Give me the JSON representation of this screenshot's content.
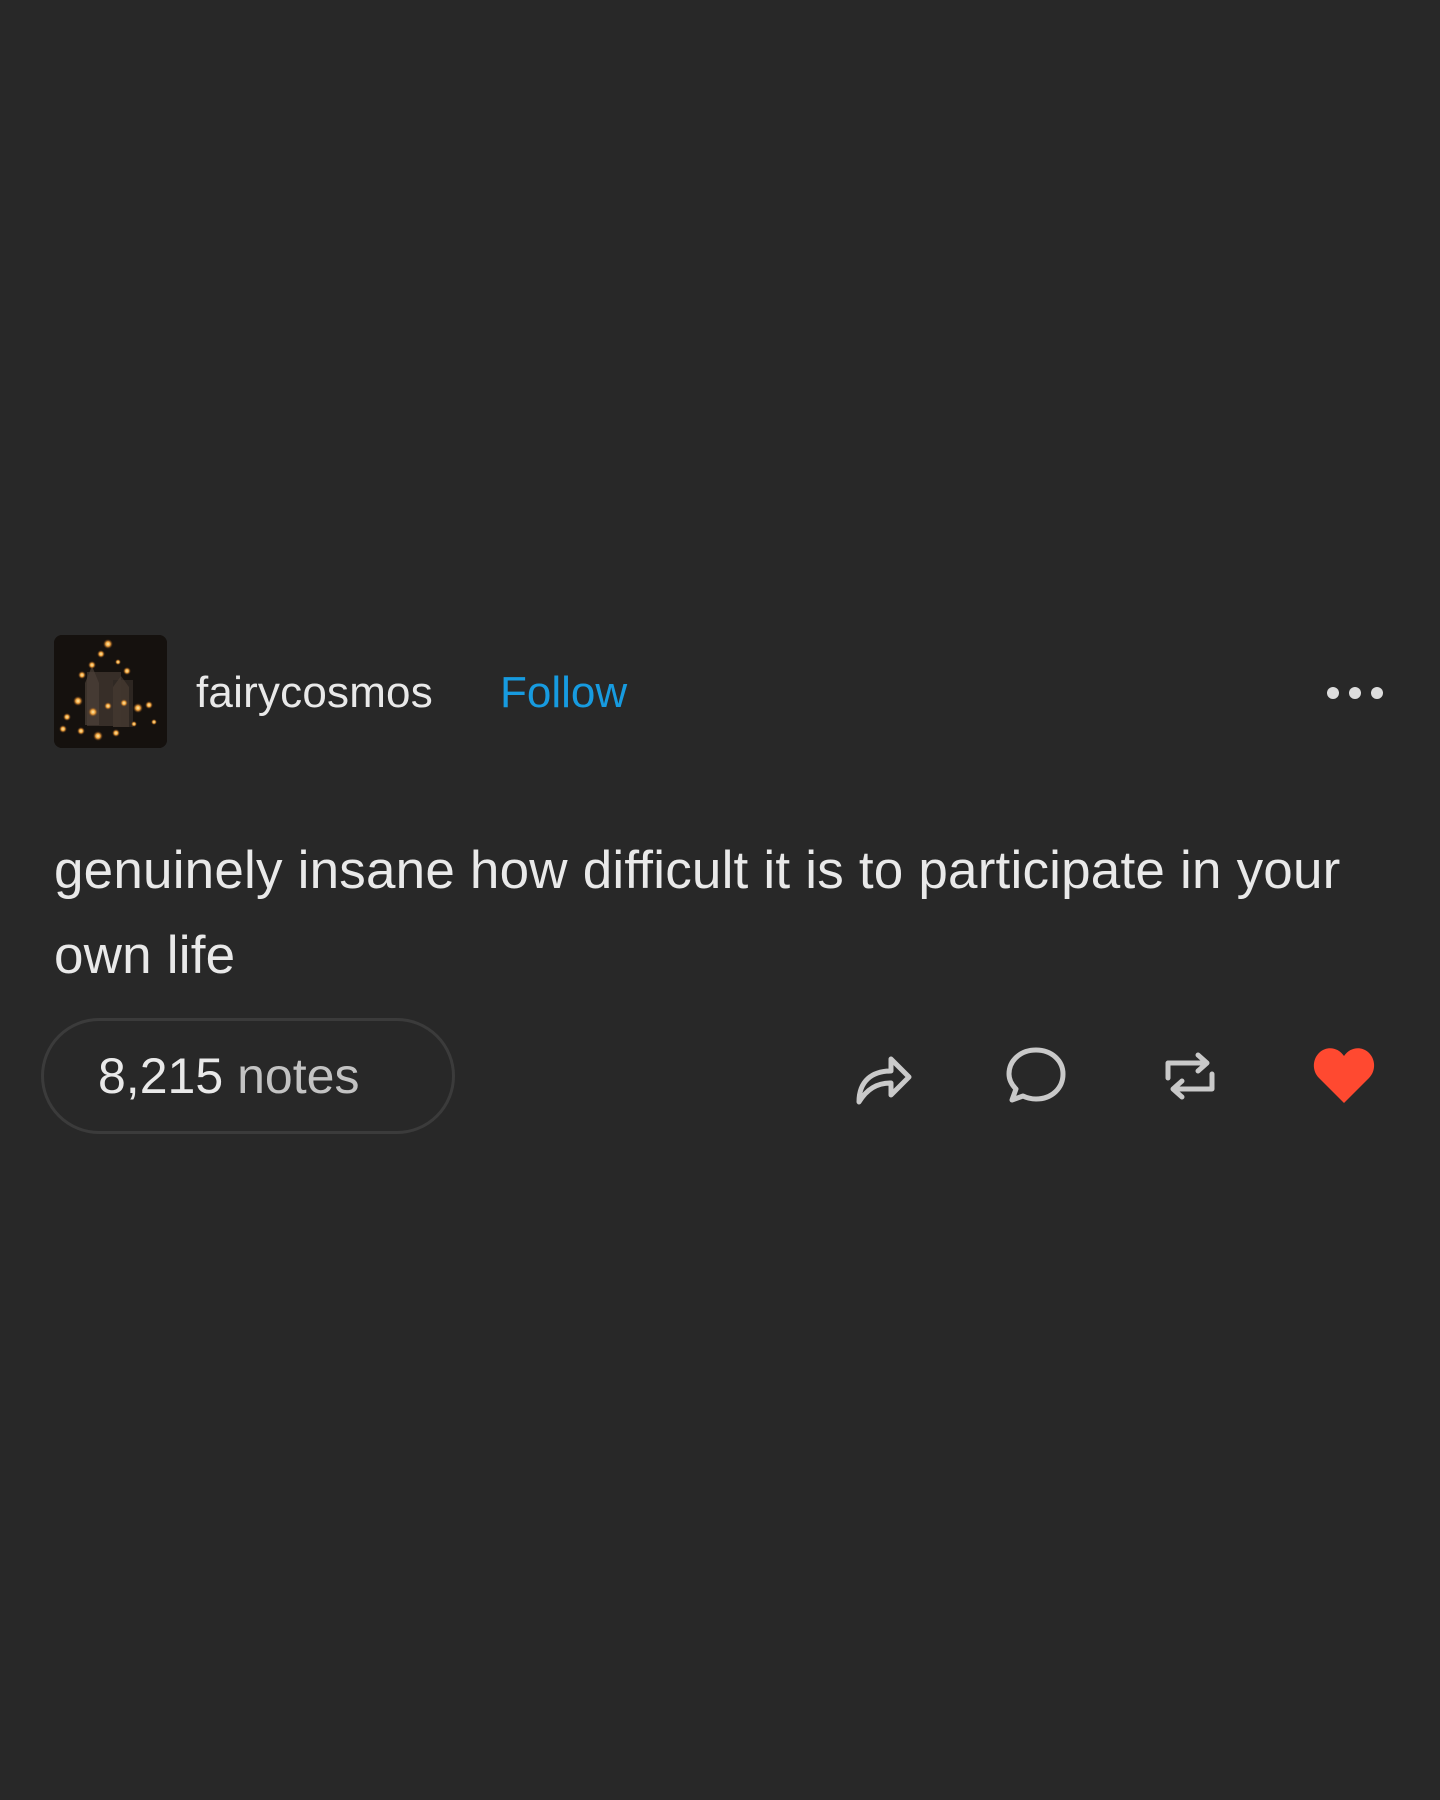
{
  "post": {
    "username": "fairycosmos",
    "follow_label": "Follow",
    "body_text": "genuinely insane how difficult it is to participate in your own life",
    "notes": {
      "count": "8,215",
      "label": "notes"
    },
    "actions": {
      "share_icon": "share-arrow-icon",
      "reply_icon": "speech-bubble-icon",
      "reblog_icon": "reblog-arrows-icon",
      "like_icon": "heart-icon",
      "like_state": "liked"
    },
    "more_icon": "ellipsis-icon"
  },
  "colors": {
    "background": "#282828",
    "text": "#e9e9e9",
    "secondary_text": "#c3c3c3",
    "follow": "#179be0",
    "heart": "#ff4930",
    "icon": "#c9c9c9"
  }
}
